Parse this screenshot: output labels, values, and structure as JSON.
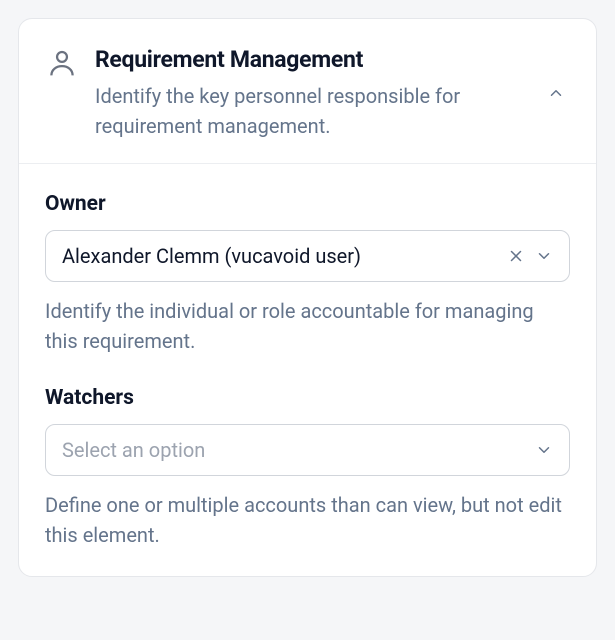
{
  "header": {
    "title": "Requirement Management",
    "subtitle": "Identify the key personnel responsible for requirement management."
  },
  "fields": {
    "owner": {
      "label": "Owner",
      "value": "Alexander Clemm (vucavoid user)",
      "help": "Identify the individual or role accountable for managing this requirement."
    },
    "watchers": {
      "label": "Watchers",
      "placeholder": "Select an option",
      "help": "Define one or multiple accounts than can view, but not edit this element."
    }
  }
}
